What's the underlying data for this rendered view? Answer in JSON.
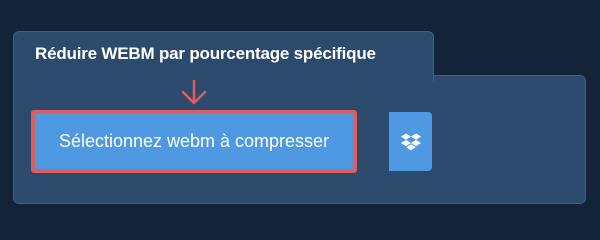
{
  "card": {
    "title": "Réduire WEBM par pourcentage spécifique"
  },
  "upload": {
    "select_label": "Sélectionnez webm à compresser",
    "dropbox_icon": "dropbox-icon"
  },
  "colors": {
    "page_background": "#13233a",
    "panel_background": "#2b4a6c",
    "button_blue": "#4f99e3",
    "highlight_red": "#de5d5d"
  }
}
